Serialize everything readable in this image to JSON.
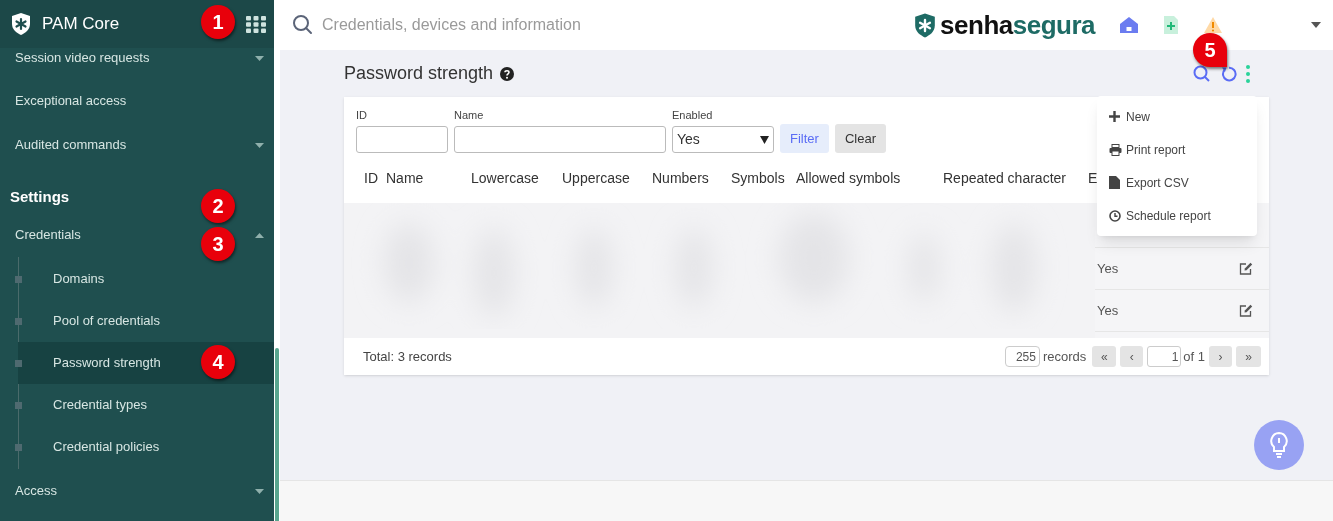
{
  "sidebar": {
    "app_name": "PAM Core",
    "items": [
      {
        "label": "Session video requests",
        "kind": "group",
        "expanded": false
      },
      {
        "label": "Exceptional access",
        "kind": "link"
      },
      {
        "label": "Audited commands",
        "kind": "group",
        "expanded": false
      },
      {
        "label": "Settings",
        "kind": "heading"
      },
      {
        "label": "Credentials",
        "kind": "group",
        "expanded": true,
        "children": [
          {
            "label": "Domains",
            "selected": false
          },
          {
            "label": "Pool of credentials",
            "selected": false
          },
          {
            "label": "Password strength",
            "selected": true
          },
          {
            "label": "Credential types",
            "selected": false
          },
          {
            "label": "Credential policies",
            "selected": false
          }
        ]
      },
      {
        "label": "Access",
        "kind": "group",
        "expanded": false
      }
    ]
  },
  "topbar": {
    "search": {
      "placeholder": "Credentials, devices and information"
    },
    "brand": {
      "part_1": "senha",
      "part_2": "segura"
    }
  },
  "page": {
    "title": "Password strength",
    "filters": [
      {
        "label": "ID",
        "kind": "text"
      },
      {
        "label": "Name",
        "kind": "text"
      },
      {
        "label": "Enabled",
        "kind": "select",
        "value": "Yes"
      }
    ],
    "filter_buttons": [
      {
        "label": "Filter",
        "kind": "primary"
      },
      {
        "label": "Clear",
        "kind": "secondary"
      }
    ],
    "table": {
      "columns": [
        "ID",
        "Name",
        "Lowercase",
        "Uppercase",
        "Numbers",
        "Symbols",
        "Allowed symbols",
        "Repeated character",
        "E"
      ],
      "rows": [
        {
          "column_9": "Yes"
        },
        {
          "column_9": "Yes"
        }
      ]
    },
    "total": "Total: 3 records",
    "page_size": "255",
    "page_size_label": "records",
    "pager": {
      "first": "«",
      "prev": "‹",
      "page": "1",
      "of": "of 1",
      "next": "›",
      "last": "»"
    }
  },
  "menu": {
    "items": [
      {
        "label": "New",
        "kind": "new"
      },
      {
        "label": "Print report",
        "kind": "print"
      },
      {
        "label": "Export CSV",
        "kind": "file"
      },
      {
        "label": "Schedule report",
        "kind": "clock"
      }
    ]
  },
  "callouts": [
    "1",
    "2",
    "3",
    "4",
    "5"
  ]
}
